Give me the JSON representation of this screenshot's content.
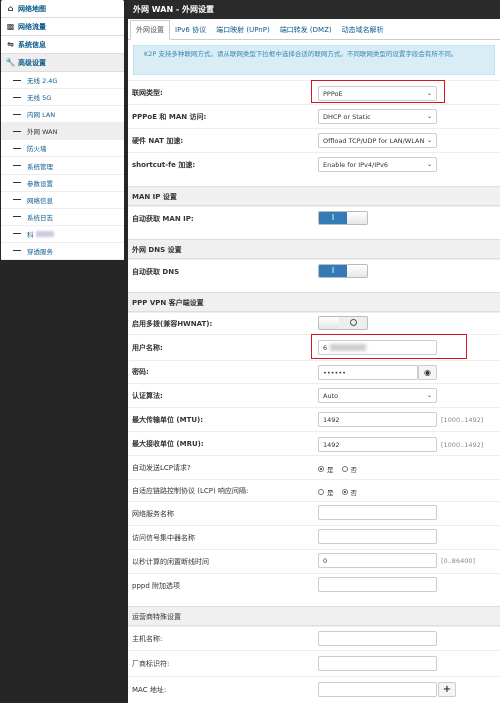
{
  "sidebar": {
    "top_items": [
      {
        "label": "网络地图",
        "icon": "home-icon"
      },
      {
        "label": "网络流量",
        "icon": "chart-icon"
      },
      {
        "label": "系统信息",
        "icon": "shuffle-icon"
      },
      {
        "label": "高级设置",
        "icon": "wrench-icon"
      }
    ],
    "sub_items": [
      "无线 2.4G",
      "无线 5G",
      "内网 LAN",
      "外网 WAN",
      "防火墙",
      "系统管理",
      "参数设置",
      "网络信息",
      "系统日志",
      "科",
      "穿透服务"
    ]
  },
  "header": {
    "title": "外网 WAN - 外网设置"
  },
  "tabs": [
    "外网设置",
    "IPv6 协议",
    "端口映射 (UPnP)",
    "端口转发 (DMZ)",
    "动态域名解析"
  ],
  "info_text": "K2P 支持多种联网方式。请从联网类型下拉框中选择合适的联网方式。不同联网类型的设置字段会有所不同。",
  "fields": {
    "wan_type": {
      "label": "联网类型:",
      "value": "PPPoE"
    },
    "pppoe_man": {
      "label": "PPPoE 和 MAN 访问:",
      "value": "DHCP or Static"
    },
    "hw_nat": {
      "label": "硬件 NAT 加速:",
      "value": "Offload TCP/UDP for LAN/WLAN"
    },
    "shortcut_fe": {
      "label": "shortcut-fe 加速:",
      "value": "Enable for IPv4/IPv6"
    }
  },
  "sections": {
    "man_ip": "MAN IP 设置",
    "wan_dns": "外网 DNS 设置",
    "ppp_vpn": "PPP VPN 客户端设置",
    "isp": "运营商特殊设置"
  },
  "man_auto_ip": {
    "label": "自动获取 MAN IP:",
    "state": "I"
  },
  "dns_auto": {
    "label": "自动获取 DNS",
    "state": "I"
  },
  "multi_dial": {
    "label": "启用多拨(兼容HWNAT):"
  },
  "username": {
    "label": "用户名称:",
    "value": "6"
  },
  "password": {
    "label": "密码:",
    "value": "••••••"
  },
  "auth": {
    "label": "认证算法:",
    "value": "Auto"
  },
  "mtu": {
    "label": "最大传输单位 (MTU):",
    "value": "1492",
    "hint": "[1000..1492]"
  },
  "mru": {
    "label": "最大接收单位 (MRU):",
    "value": "1492",
    "hint": "[1000..1492]"
  },
  "lcp_request": {
    "label": "自动发送LCP请求?",
    "yes": "是",
    "no": "否"
  },
  "lcp_adaptive": {
    "label": "自适应链路控制协议 (LCP) 响应间隔:",
    "yes": "是",
    "no": "否"
  },
  "service_name": {
    "label": "网络服务名称"
  },
  "ac_name": {
    "label": "访问信号集中器名称"
  },
  "idle_time": {
    "label": "以秒计算的闲置断线时间",
    "value": "0",
    "hint": "[0..86400]"
  },
  "pppd_opts": {
    "label": "pppd 附加选项"
  },
  "hostname": {
    "label": "主机名称:"
  },
  "vendor": {
    "label": "厂商标识符:"
  },
  "mac": {
    "label": "MAC 地址:",
    "button": "+"
  }
}
